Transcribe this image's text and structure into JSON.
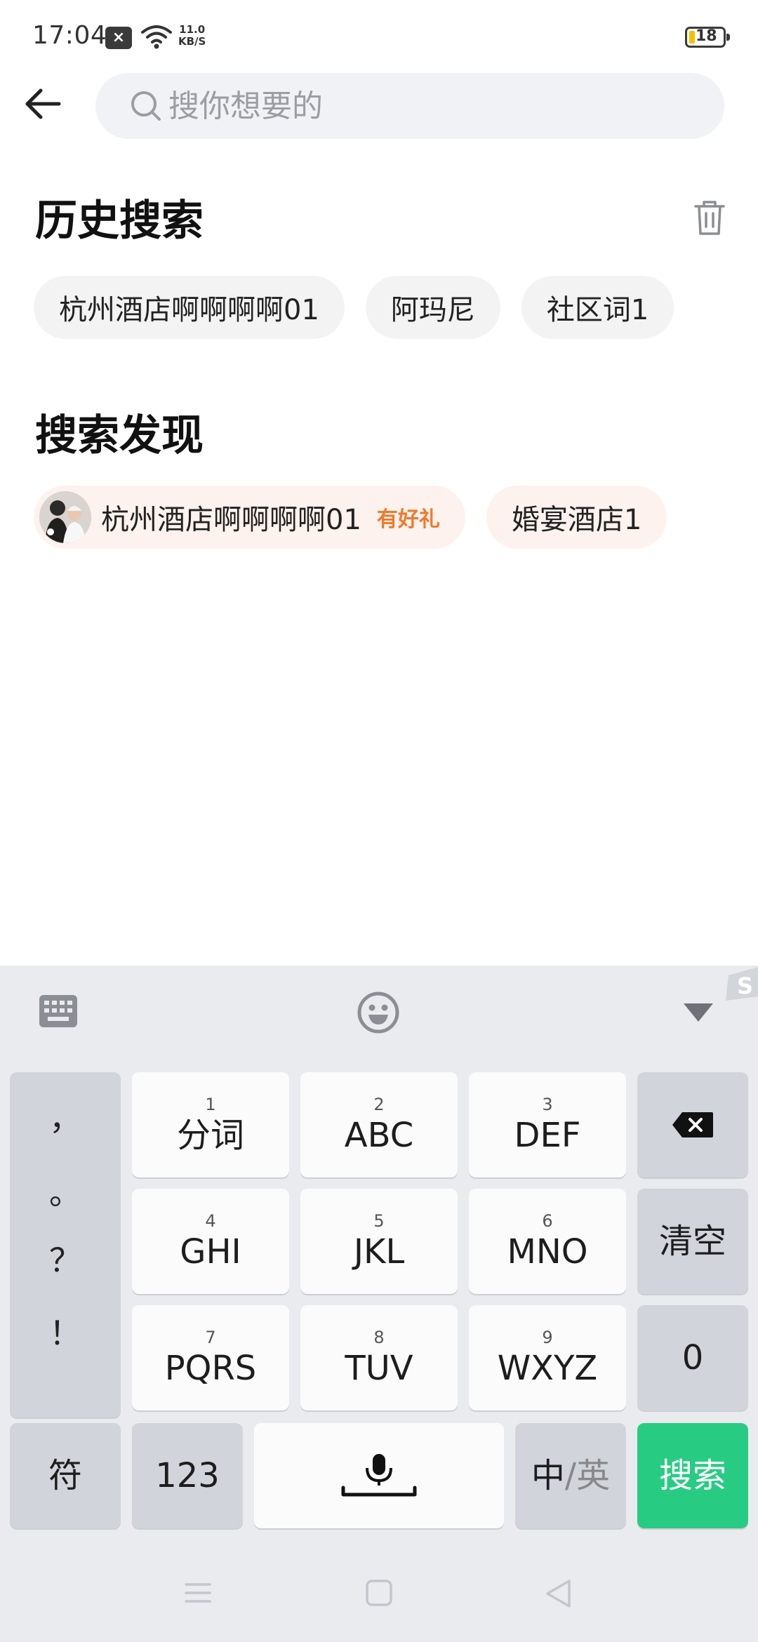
{
  "status": {
    "time": "17:04",
    "notif_symbol": "×",
    "speed_value": "11.0",
    "speed_unit": "KB/S",
    "battery": "18",
    "battery_level": 0.18
  },
  "search": {
    "placeholder": "搜你想要的",
    "value": ""
  },
  "history": {
    "title": "历史搜索",
    "items": [
      "杭州酒店啊啊啊啊01",
      "阿玛尼",
      "社区词1"
    ]
  },
  "discover": {
    "title": "搜索发现",
    "items": [
      {
        "label": "杭州酒店啊啊啊啊01",
        "badge": "有好礼"
      },
      {
        "label": "婚宴酒店1"
      }
    ]
  },
  "keyboard": {
    "punct": [
      "，",
      "。",
      "？",
      "！"
    ],
    "keys": [
      {
        "num": "1",
        "main": "分词"
      },
      {
        "num": "2",
        "main": "ABC"
      },
      {
        "num": "3",
        "main": "DEF"
      },
      {
        "num": "4",
        "main": "GHI"
      },
      {
        "num": "5",
        "main": "JKL"
      },
      {
        "num": "6",
        "main": "MNO"
      },
      {
        "num": "7",
        "main": "PQRS"
      },
      {
        "num": "8",
        "main": "TUV"
      },
      {
        "num": "9",
        "main": "WXYZ"
      }
    ],
    "clear": "清空",
    "zero": "0",
    "symbols": "符",
    "numbers": "123",
    "lang_zh": "中",
    "lang_sep": "/",
    "lang_en": "英",
    "submit": "搜索"
  },
  "colors": {
    "accent_green": "#27cc82",
    "badge_orange": "#f07a2c",
    "chip_warm_bg": "#fdf2ed"
  }
}
